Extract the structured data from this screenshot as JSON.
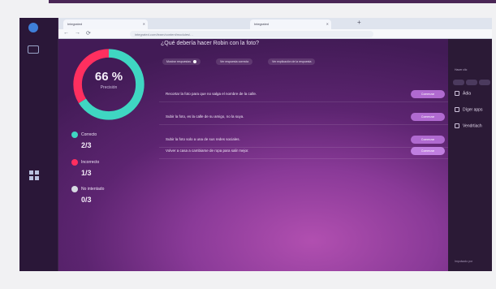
{
  "browser": {
    "tabs": [
      {
        "label": "Integrated"
      },
      {
        "label": "Integrated"
      }
    ],
    "new_tab": "+",
    "nav": {
      "back": "←",
      "forward": "→",
      "reload": "⟳"
    },
    "url": "integrated.com/learn/content/modules/…"
  },
  "question": {
    "title": "¿Qué debería hacer Robin con la foto?",
    "filters": [
      {
        "label": "Mostrar respuestas",
        "toggle": true
      },
      {
        "label": "Ver respuesta correcta",
        "toggle": false
      },
      {
        "label": "Ver explicación de la respuesta",
        "toggle": false
      }
    ]
  },
  "answers": [
    {
      "text": "Recortar la foto para que no salga el nombre de la calle.",
      "button": "Comenzar",
      "selected": false
    },
    {
      "text": "Subir la foto, es la calle de su amigo, no la suya.",
      "button": "Comenzar",
      "selected": false
    },
    {
      "text": "Subir la foto solo a una de sus redes sociales.",
      "button": "Comenzar",
      "selected": false
    },
    {
      "text": "Volver a casa a cambiarse de ropa para salir mejor.",
      "button": "Comenzar",
      "selected": true
    }
  ],
  "score": {
    "percent_label": "66 %",
    "subtitle": "Precisión",
    "percent": 66,
    "colors": {
      "correct": "#3fd6c2",
      "incorrect": "#ff2f5f",
      "skipped": "#cfd3de"
    }
  },
  "stats": [
    {
      "label": "Correcto",
      "value": "2/3",
      "color": "#3fd6c2"
    },
    {
      "label": "Incorrecto",
      "value": "1/3",
      "color": "#ff2f5f"
    },
    {
      "label": "No intentado",
      "value": "0/3",
      "color": "#d6d9e2"
    }
  ],
  "sidebar": {
    "title": "Hacer clic",
    "items": [
      {
        "label": "Ádia",
        "icon": "document-icon"
      },
      {
        "label": "Díger apps",
        "icon": "apps-icon"
      },
      {
        "label": "Vendrtiach",
        "icon": "settings-icon"
      }
    ],
    "footer": "Impulsado por"
  },
  "rail": {
    "icons": [
      "account-badge-icon",
      "panel-icon",
      "grid-icon"
    ]
  }
}
